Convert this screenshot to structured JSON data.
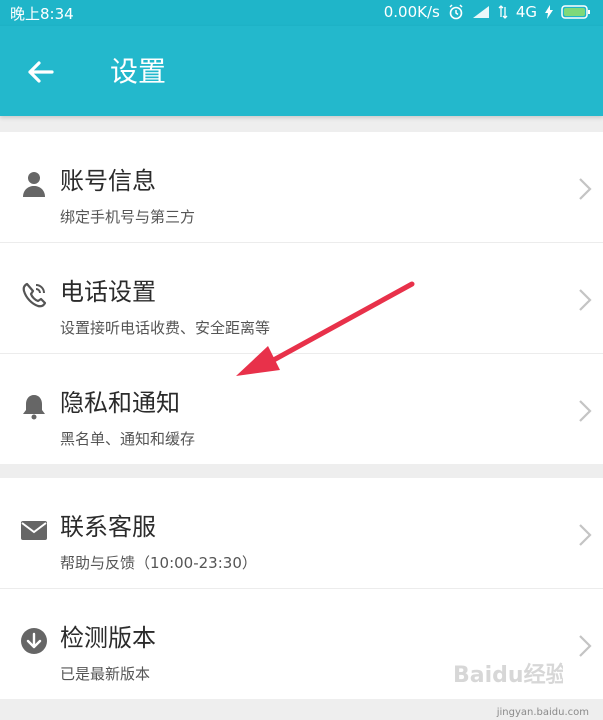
{
  "status_bar": {
    "time": "晚上8:34",
    "speed": "0.00K/s",
    "network": "4G"
  },
  "app_bar": {
    "title": "设置"
  },
  "groups": [
    {
      "items": [
        {
          "title": "账号信息",
          "subtitle": "绑定手机号与第三方",
          "icon": "person-icon"
        },
        {
          "title": "电话设置",
          "subtitle": "设置接听电话收费、安全距离等",
          "icon": "phone-icon"
        },
        {
          "title": "隐私和通知",
          "subtitle": "黑名单、通知和缓存",
          "icon": "bell-icon"
        }
      ]
    },
    {
      "items": [
        {
          "title": "联系客服",
          "subtitle": "帮助与反馈（10:00-23:30）",
          "icon": "mail-icon"
        },
        {
          "title": "检测版本",
          "subtitle": "已是最新版本",
          "icon": "download-circle-icon"
        }
      ]
    }
  ],
  "watermark": {
    "brand": "Baidu经验",
    "url": "jingyan.baidu.com"
  },
  "colors": {
    "primary": "#23b8cc",
    "annotation_arrow": "#e8314a"
  }
}
